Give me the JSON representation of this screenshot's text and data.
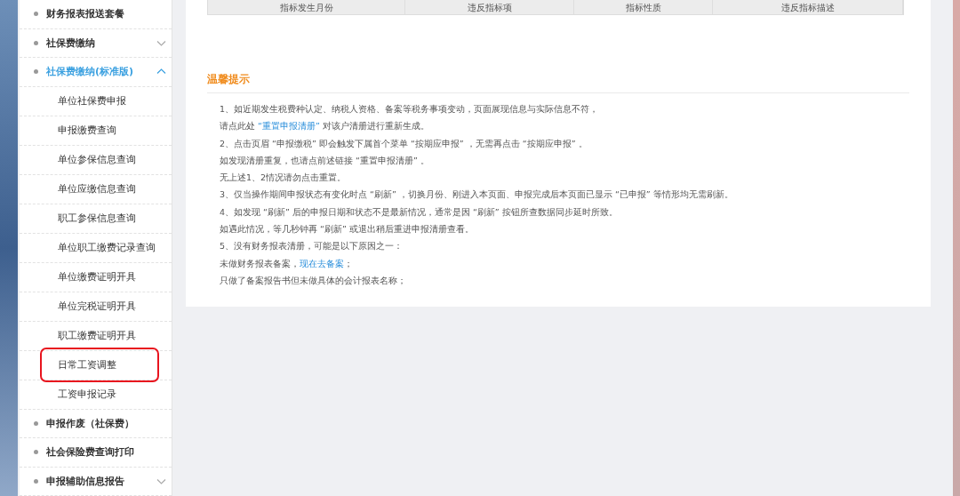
{
  "sidebar": {
    "items": [
      {
        "label": "财务报表报送套餐",
        "selected": false
      },
      {
        "label": "社保费缴纳",
        "selected": false,
        "expanded": false
      },
      {
        "label": "社保费缴纳(标准版)",
        "selected": true,
        "expanded": true,
        "children": [
          {
            "label": "单位社保费申报",
            "highlighted": false
          },
          {
            "label": "申报缴费查询",
            "highlighted": false
          },
          {
            "label": "单位参保信息查询",
            "highlighted": false
          },
          {
            "label": "单位应缴信息查询",
            "highlighted": false
          },
          {
            "label": "职工参保信息查询",
            "highlighted": false
          },
          {
            "label": "单位职工缴费记录查询",
            "highlighted": false
          },
          {
            "label": "单位缴费证明开具",
            "highlighted": false
          },
          {
            "label": "单位完税证明开具",
            "highlighted": false
          },
          {
            "label": "职工缴费证明开具",
            "highlighted": false
          },
          {
            "label": "日常工资调整",
            "highlighted": true
          },
          {
            "label": "工资申报记录",
            "highlighted": false
          }
        ]
      },
      {
        "label": "申报作废（社保费）",
        "selected": false
      },
      {
        "label": "社会保险费查询打印",
        "selected": false
      },
      {
        "label": "申报辅助信息报告",
        "selected": false,
        "expanded": false
      }
    ]
  },
  "table": {
    "columns": [
      "指标发生月份",
      "违反指标项",
      "指标性质",
      "违反指标描述"
    ]
  },
  "tips": {
    "title": "温馨提示",
    "lines": [
      [
        {
          "kind": "text",
          "text": "1、如近期发生税费种认定、纳税人资格、备案等税务事项变动，页面展现信息与实际信息不符，"
        }
      ],
      [
        {
          "kind": "text",
          "text": "请点此处 "
        },
        {
          "kind": "link",
          "text": "“重置申报清册”"
        },
        {
          "kind": "text",
          "text": " 对该户清册进行重新生成。"
        }
      ],
      [
        {
          "kind": "text",
          "text": "2、点击页眉 “申报缴税” 即会触发下属首个菜单 “按期应申报” ，无需再点击 “按期应申报” 。"
        }
      ],
      [
        {
          "kind": "text",
          "text": "如发现清册重复，也请点前述链接 “重置申报清册” 。"
        }
      ],
      [
        {
          "kind": "text",
          "text": "无上述1、2情况请勿点击重置。"
        }
      ],
      [
        {
          "kind": "text",
          "text": "3、仅当操作期间申报状态有变化时点 “刷新” ，切换月份、刚进入本页面、申报完成后本页面已显示 “已申报” 等情形均无需刷新。"
        }
      ],
      [
        {
          "kind": "text",
          "text": "4、如发现 “刷新” 后的申报日期和状态不是最新情况，通常是因 “刷新” 按钮所查数据同步延时所致。"
        }
      ],
      [
        {
          "kind": "text",
          "text": "如遇此情况，等几秒钟再 “刷新” 或退出稍后重进申报清册查看。"
        }
      ],
      [
        {
          "kind": "text",
          "text": "5、没有财务报表清册，可能是以下原因之一："
        }
      ],
      [
        {
          "kind": "text",
          "text": "未做财务报表备案，"
        },
        {
          "kind": "link",
          "text": "现在去备案"
        },
        {
          "kind": "text",
          "text": "；"
        }
      ],
      [
        {
          "kind": "text",
          "text": "只做了备案报告书但未做具体的会计报表名称；"
        }
      ]
    ]
  }
}
